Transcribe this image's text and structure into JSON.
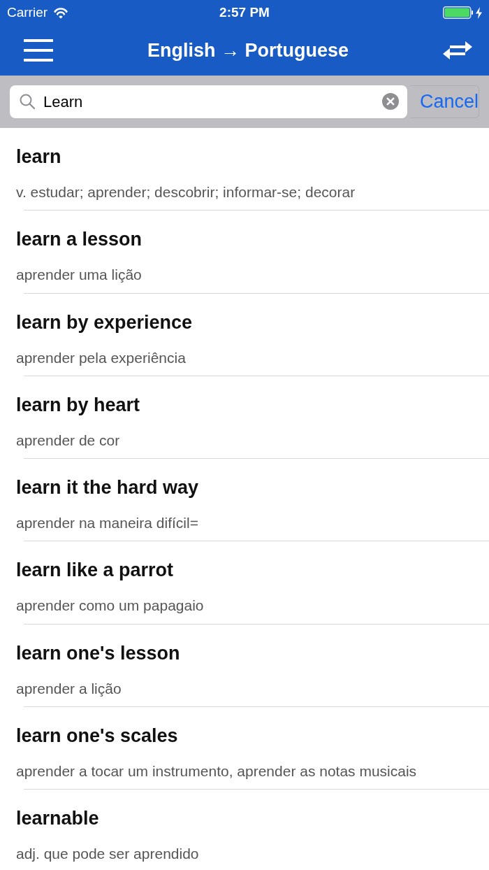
{
  "status_bar": {
    "carrier": "Carrier",
    "time": "2:57 PM"
  },
  "nav_bar": {
    "title": "English → Portuguese"
  },
  "search": {
    "value": "Learn",
    "cancel": "Cancel"
  },
  "results": [
    {
      "term": "learn",
      "translation": "v. estudar; aprender; descobrir; informar-se; decorar"
    },
    {
      "term": "learn a lesson",
      "translation": "aprender uma lição"
    },
    {
      "term": "learn by experience",
      "translation": "aprender pela experiência"
    },
    {
      "term": "learn by heart",
      "translation": "aprender de cor"
    },
    {
      "term": "learn it the hard way",
      "translation": "aprender na maneira difícil="
    },
    {
      "term": "learn like a parrot",
      "translation": "aprender como um papagaio"
    },
    {
      "term": "learn one's lesson",
      "translation": "aprender a lição"
    },
    {
      "term": "learn one's scales",
      "translation": "aprender a tocar um instrumento, aprender as notas musicais"
    },
    {
      "term": "learnable",
      "translation": "adj. que pode ser aprendido"
    }
  ]
}
